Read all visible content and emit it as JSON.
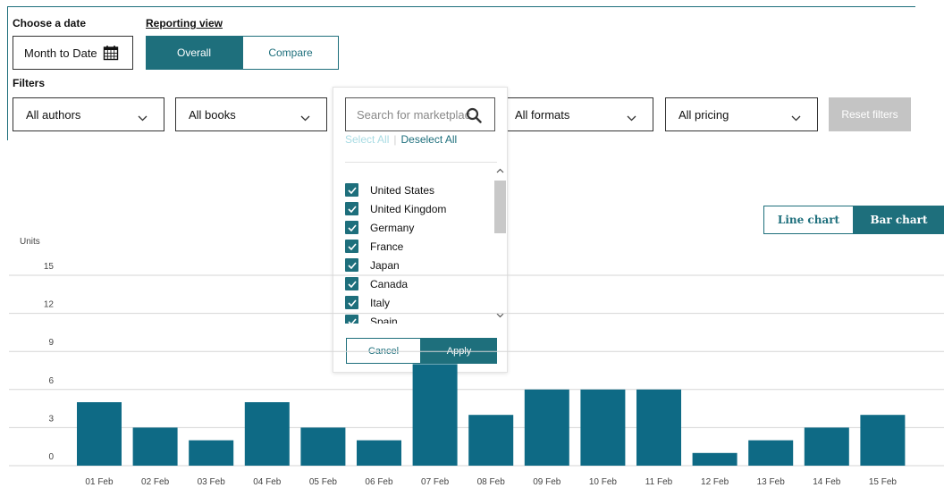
{
  "date": {
    "label": "Choose a date",
    "value": "Month to Date"
  },
  "reporting": {
    "label": "Reporting view",
    "tabs": [
      "Overall",
      "Compare"
    ],
    "active": "Overall"
  },
  "filters": {
    "label": "Filters",
    "authors": "All authors",
    "books": "All books",
    "marketplace_placeholder": "Search for marketplac",
    "formats": "All formats",
    "pricing": "All pricing",
    "reset": "Reset filters"
  },
  "marketplace_panel": {
    "select_all": "Select All",
    "deselect_all": "Deselect All",
    "items": [
      "United States",
      "United Kingdom",
      "Germany",
      "France",
      "Japan",
      "Canada",
      "Italy",
      "Spain"
    ],
    "cancel": "Cancel",
    "apply": "Apply"
  },
  "chart_toggle": {
    "line": "Line chart",
    "bar": "Bar chart",
    "active": "Bar chart"
  },
  "colors": {
    "accent": "#1e6f7c",
    "bar": "#0e6a85",
    "disabled": "#c4c4c4"
  },
  "chart_data": {
    "type": "bar",
    "ylabel": "Units",
    "ylim": [
      0,
      15
    ],
    "yticks": [
      0,
      3,
      6,
      9,
      12,
      15
    ],
    "grid": true,
    "categories": [
      "01 Feb",
      "02 Feb",
      "03 Feb",
      "04 Feb",
      "05 Feb",
      "06 Feb",
      "07 Feb",
      "08 Feb",
      "09 Feb",
      "10 Feb",
      "11 Feb",
      "12 Feb",
      "13 Feb",
      "14 Feb",
      "15 Feb"
    ],
    "values": [
      5,
      3,
      2,
      5,
      3,
      2,
      8,
      4,
      6,
      6,
      6,
      1,
      2,
      3,
      4
    ]
  }
}
